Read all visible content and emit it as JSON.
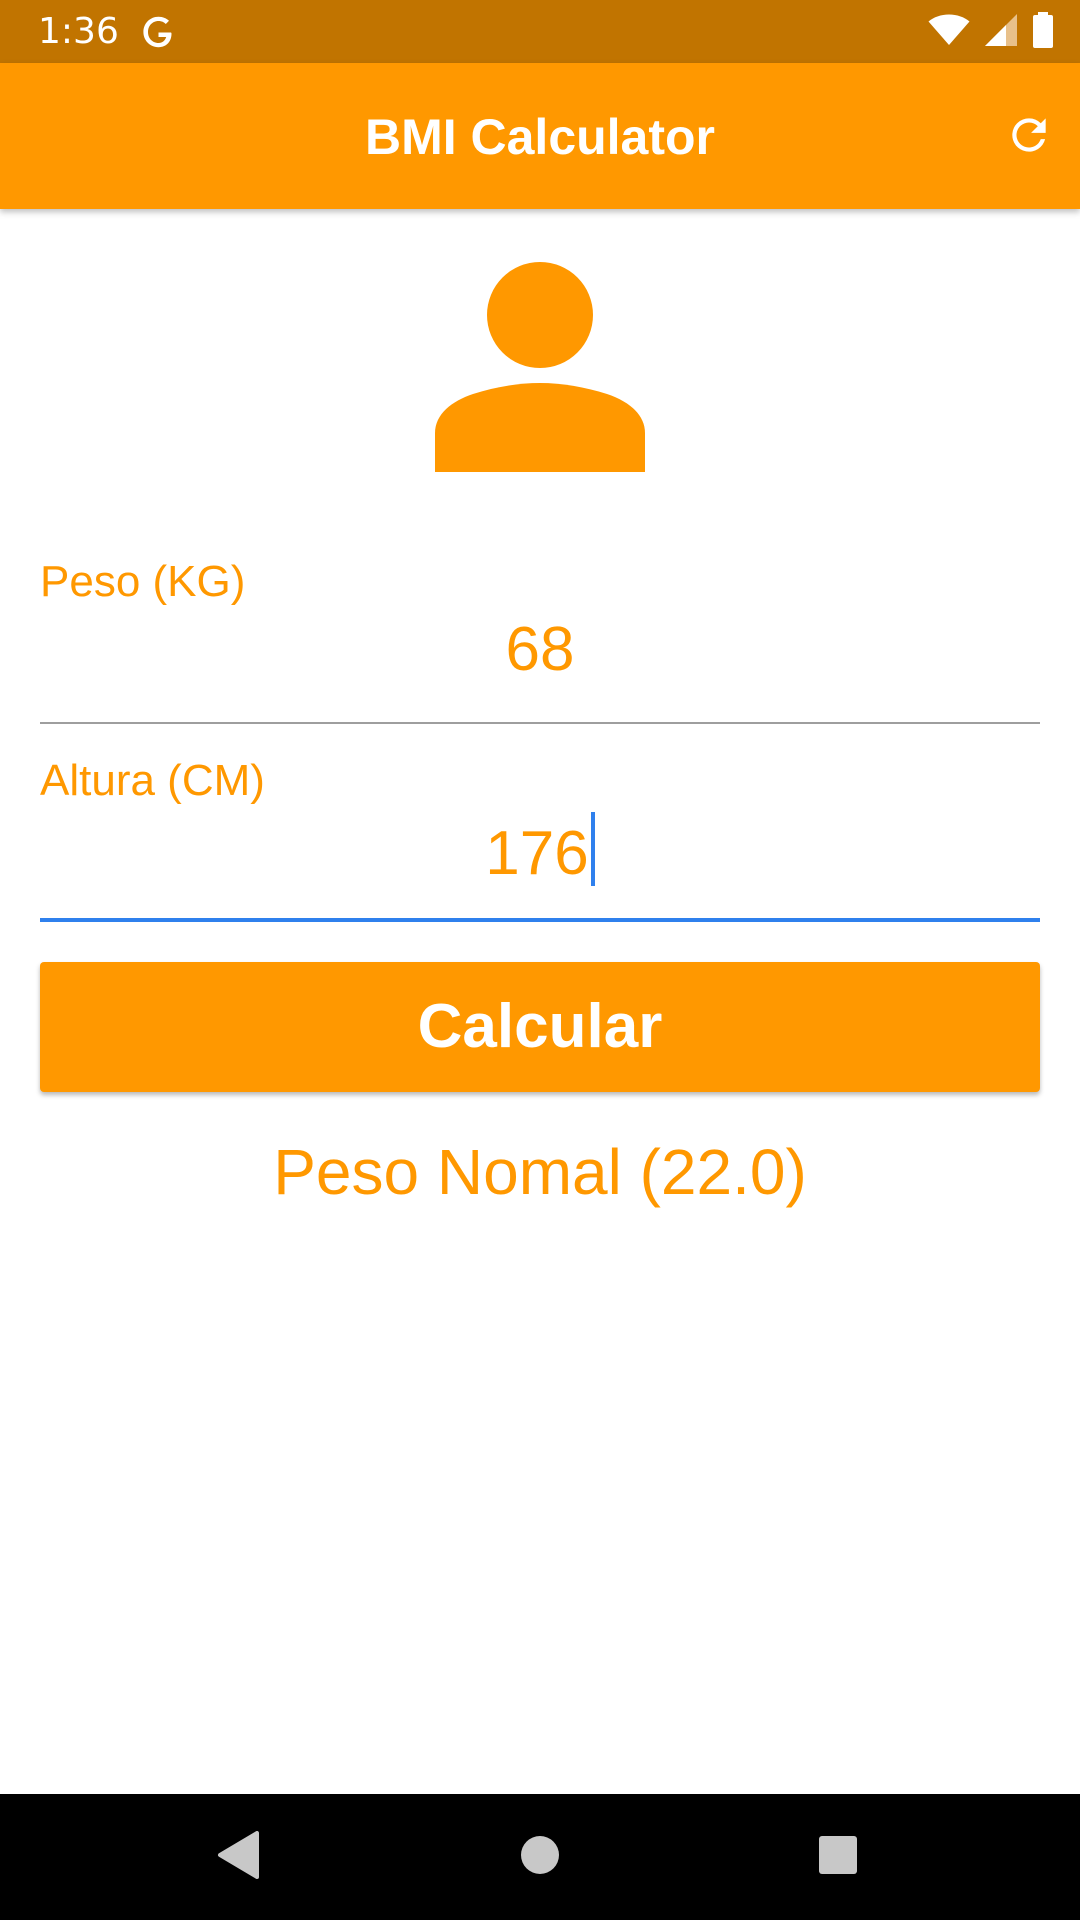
{
  "status_bar": {
    "time": "1:36",
    "notification_icon": "google-g-icon",
    "icons": [
      "wifi-icon",
      "cell-signal-icon",
      "battery-icon"
    ]
  },
  "app_bar": {
    "title": "BMI Calculator",
    "action_icon": "refresh-icon"
  },
  "avatar": {
    "icon": "person-icon"
  },
  "form": {
    "weight": {
      "label": "Peso (KG)",
      "value": "68"
    },
    "height": {
      "label": "Altura (CM)",
      "value": "176"
    }
  },
  "calculate_button": {
    "label": "Calcular"
  },
  "result": {
    "text": "Peso Nomal (22.0)"
  },
  "nav_bar": {
    "icons": [
      "back-icon",
      "home-icon",
      "recents-icon"
    ]
  },
  "colors": {
    "primary": "#ff9800",
    "primary_dark": "#c17400",
    "accent": "#2f80ed",
    "on_primary": "#ffffff"
  }
}
